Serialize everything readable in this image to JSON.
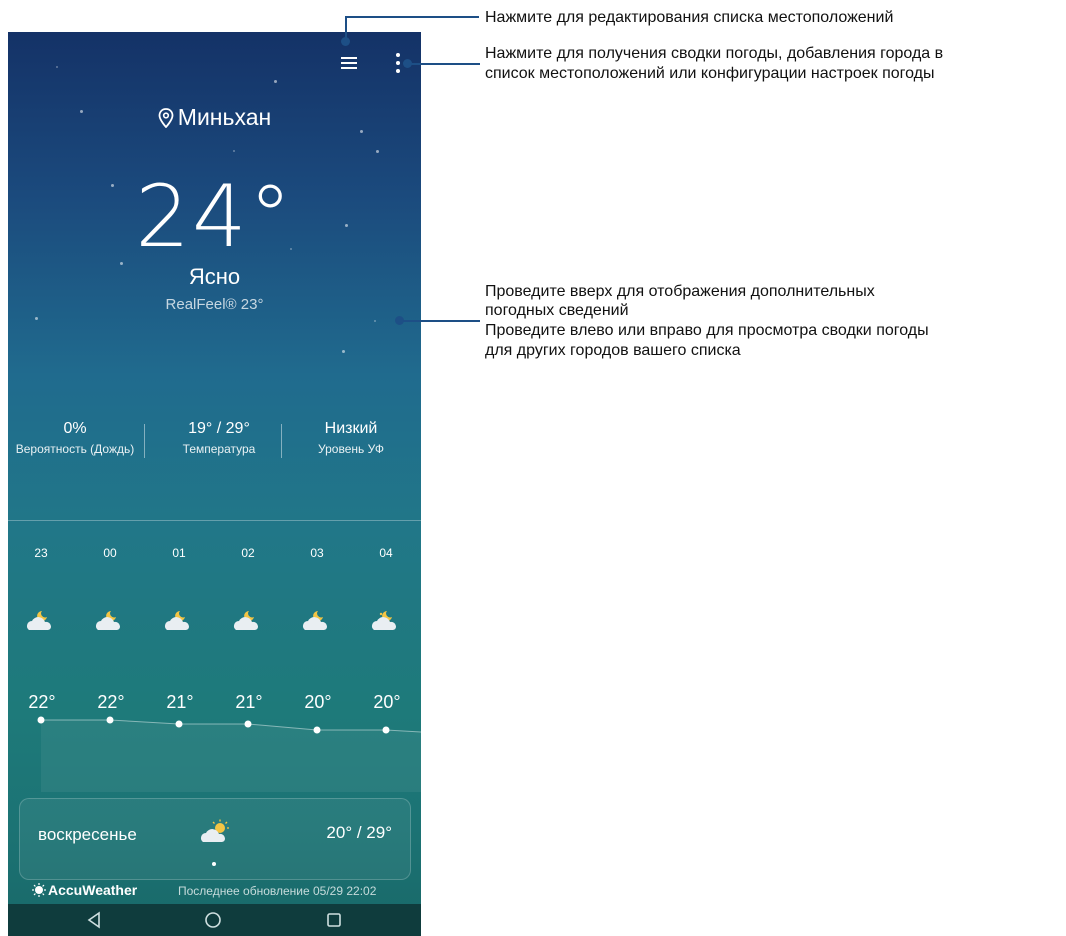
{
  "location": "Миньхан",
  "current": {
    "temperature": "24°",
    "condition": "Ясно",
    "realfeel": "RealFeel® 23°"
  },
  "stats": [
    {
      "value": "0%",
      "label": "Вероятность (Дождь)"
    },
    {
      "value": "19° / 29°",
      "label": "Температура"
    },
    {
      "value": "Низкий",
      "label": "Уровень УФ"
    }
  ],
  "hourly": [
    {
      "hour": "23",
      "temp": "22°",
      "icon": "partly-cloudy-night-icon"
    },
    {
      "hour": "00",
      "temp": "22°",
      "icon": "partly-cloudy-night-icon"
    },
    {
      "hour": "01",
      "temp": "21°",
      "icon": "partly-cloudy-night-icon"
    },
    {
      "hour": "02",
      "temp": "21°",
      "icon": "partly-cloudy-night-icon"
    },
    {
      "hour": "03",
      "temp": "20°",
      "icon": "partly-cloudy-night-icon"
    },
    {
      "hour": "04",
      "temp": "20°",
      "icon": "partly-cloudy-night-icon"
    }
  ],
  "daily": {
    "day": "воскресенье",
    "temps": "20° / 29°",
    "icon": "partly-sunny-icon"
  },
  "footer": {
    "brand": "AccuWeather",
    "updated": "Последнее обновление 05/29 22:02"
  },
  "annotations": {
    "edit_list": "Нажмите для редактирования списка местоположений",
    "menu_line1": "Нажмите для получения сводки погоды, добавления города в",
    "menu_line2": "список местоположений или конфигурации настроек погоды",
    "swipe_line1": "Проведите вверх для отображения дополнительных",
    "swipe_line2": "погодных сведений",
    "swipe_line3": "Проведите влево или вправо для просмотра сводки погоды",
    "swipe_line4": "для других городов вашего списка"
  },
  "colors": {
    "accent": "#1d4f86",
    "bg_top": "#143267",
    "bg_bottom": "#186868"
  }
}
